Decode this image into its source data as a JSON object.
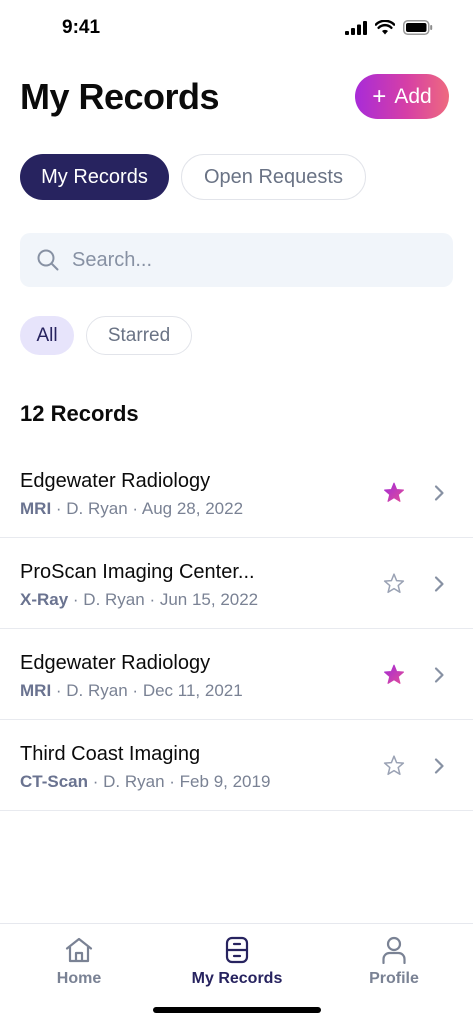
{
  "status_bar": {
    "time": "9:41"
  },
  "header": {
    "title": "My Records",
    "add_label": "Add"
  },
  "tabs": [
    {
      "label": "My Records",
      "active": true
    },
    {
      "label": "Open Requests",
      "active": false
    }
  ],
  "search": {
    "placeholder": "Search..."
  },
  "filters": [
    {
      "label": "All",
      "active": true
    },
    {
      "label": "Starred",
      "active": false
    }
  ],
  "records_count": "12 Records",
  "records": [
    {
      "name": "Edgewater Radiology",
      "type": "MRI",
      "doctor": "D. Ryan",
      "date": "Aug 28, 2022",
      "starred": true
    },
    {
      "name": "ProScan Imaging Center...",
      "type": "X-Ray",
      "doctor": "D. Ryan",
      "date": "Jun 15, 2022",
      "starred": false
    },
    {
      "name": "Edgewater Radiology",
      "type": "MRI",
      "doctor": "D. Ryan",
      "date": "Dec 11, 2021",
      "starred": true
    },
    {
      "name": "Third Coast Imaging",
      "type": "CT-Scan",
      "doctor": "D. Ryan",
      "date": "Feb 9, 2019",
      "starred": false
    }
  ],
  "bottom_nav": [
    {
      "label": "Home",
      "icon": "home-icon",
      "active": false
    },
    {
      "label": "My Records",
      "icon": "records-icon",
      "active": true
    },
    {
      "label": "Profile",
      "icon": "profile-icon",
      "active": false
    }
  ],
  "colors": {
    "primary": "#27235f",
    "accent_gradient_start": "#a82bd8",
    "accent_gradient_end": "#ee6a7f",
    "star_active": "#c23fd0",
    "muted": "#7a8294"
  }
}
